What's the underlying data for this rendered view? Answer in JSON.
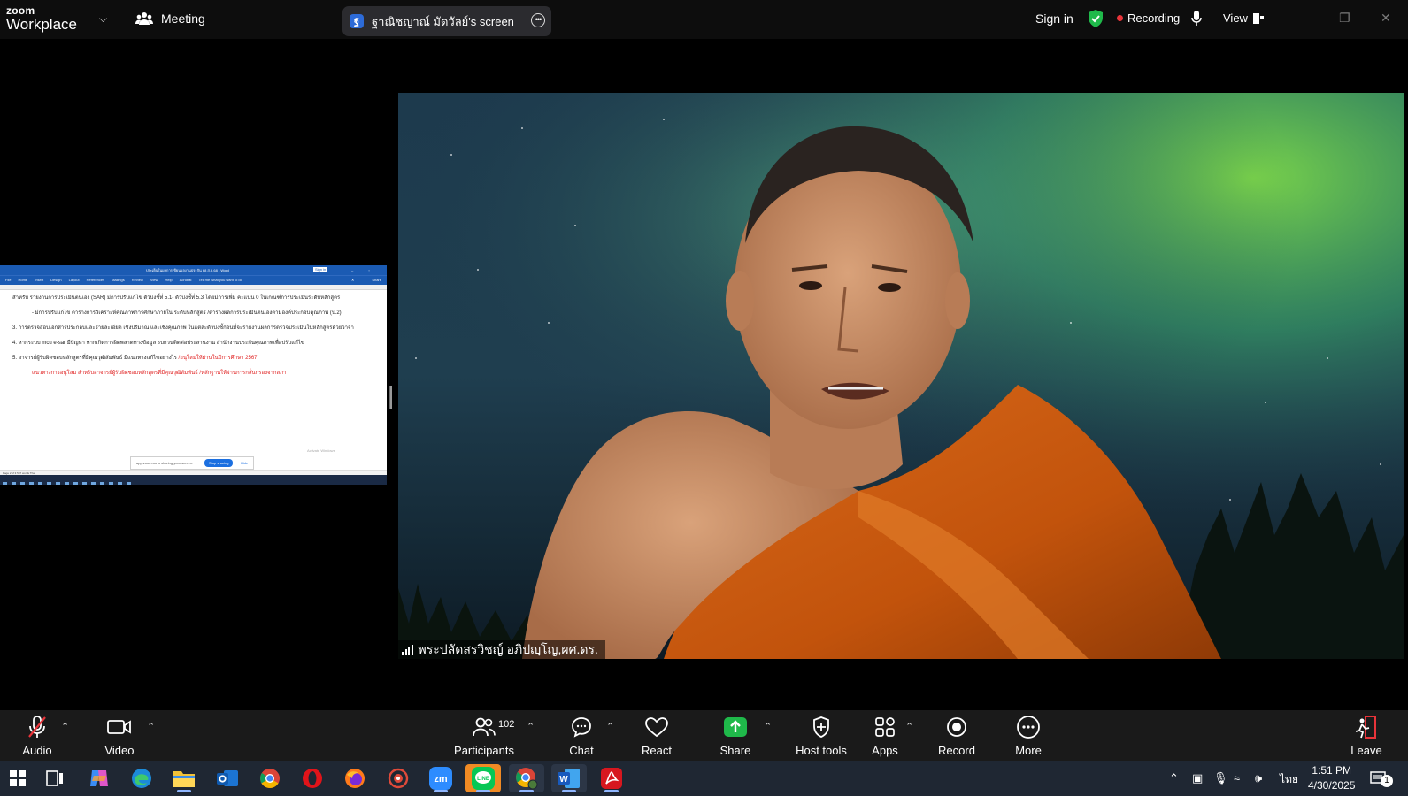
{
  "topbar": {
    "brand_line1": "zoom",
    "brand_line2": "Workplace",
    "meeting_label": "Meeting",
    "share_indicator": "ฐาณิชญาณ์ มัดวัลย์'s screen",
    "share_icon_letter": "ฐ",
    "sign_in": "Sign in",
    "recording": "Recording",
    "view": "View"
  },
  "shared_doc": {
    "title": "ประเด็นในผลการเขียนผลงานประกัน 68 ส.ย.68 - Word",
    "sign_in": "Sign in",
    "ribbon": [
      "File",
      "Home",
      "Insert",
      "Design",
      "Layout",
      "References",
      "Mailings",
      "Review",
      "View",
      "Help",
      "Acrobat",
      "Tell me what you want to do",
      "Share"
    ],
    "lines": [
      "สำหรับ รายงานการประเมินตนเอง (SAR) มีการปรับแก้ไข ตัวบ่งชี้ที่ 5.1- ตัวบ่งชี้ที่ 5.3 โดยมีการเพิ่ม คะแนน 0 ในเกณฑ์การประเมินระดับหลักสูตร",
      "- มีการปรับแก้ไข ตารางการวิเคราะห์คุณภาพการศึกษาภายใน ระดับหลักสูตร /ตารางผลการประเมินตนเองตามองค์ประกอบคุณภาพ (ป.2)",
      "3. การตรวจสอบเอกสารประกอบและรายละเอียด เชิงปริมาณ และเชิงคุณภาพ ในแต่ละตัวบ่งชี้ก่อนที่จะรายงานผลการตรวจประเมินในหลักสูตรด้วยวาจา",
      "4. หากระบบ mcu e-sar มีปัญหา หากเกิดการผิดพลาดทางข้อมูล รบกวนติดต่อประสานงาน สำนักงานประกันคุณภาพเพื่อปรับแก้ไข",
      "5. อาจารย์ผู้รับผิดชอบหลักสูตรที่มีคุณวุฒิสัมพันธ์ มีแนวทางแก้ไขอย่างไร",
      "/อนุโลมให้ผ่านในปีการศึกษา 2567",
      "แนวทางการอนุโลม สำหรับอาจารย์ผู้รับผิดชอบหลักสูตรที่มีคุณวุฒิสัมพันธ์ /หลักฐานให้ผ่านการกลั่นกรองจากสภา"
    ],
    "sharebar_text": "app.zoom.us is sharing your screen.",
    "stop_sharing": "Stop sharing",
    "hide": "Hide",
    "status": "Page 2 of 3    547 words    Thai",
    "watermark": "Activate Windows"
  },
  "participant": {
    "name": "พระปลัดสรวิชญ์  อภิปญฺโญ,ผศ.ดร."
  },
  "controls": {
    "audio": "Audio",
    "video": "Video",
    "participants": "Participants",
    "participants_count": "102",
    "chat": "Chat",
    "react": "React",
    "share": "Share",
    "host_tools": "Host tools",
    "apps": "Apps",
    "record": "Record",
    "more": "More",
    "leave": "Leave"
  },
  "colors": {
    "accent_green": "#1fb94a",
    "recording_red": "#e8343a",
    "share_green": "#1fb94a",
    "leave_red": "#e8343a"
  },
  "taskbar": {
    "apps": [
      "start-icon",
      "task-view-icon",
      "copilot-icon",
      "edge-icon",
      "file-explorer-icon",
      "outlook-icon",
      "chrome-icon",
      "opera-icon",
      "firefox-icon",
      "app-icon",
      "zoom-icon",
      "line-icon",
      "chrome-profile-icon",
      "word-icon",
      "acrobat-icon"
    ],
    "language": "ไทย",
    "time": "1:51 PM",
    "date": "4/30/2025",
    "notification_count": "1"
  }
}
